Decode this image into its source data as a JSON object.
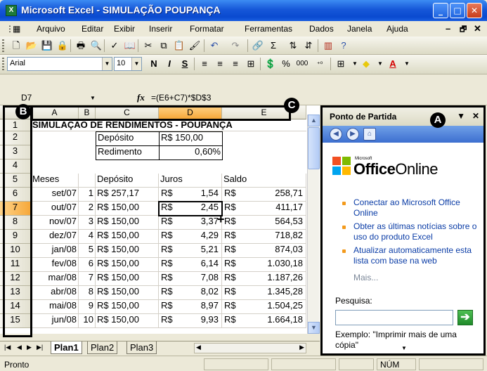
{
  "window": {
    "title": "Microsoft Excel - SIMULAÇÃO POUPANÇA",
    "app_icon": "X",
    "minimize": "_",
    "maximize": "□",
    "close": "✕"
  },
  "menu": {
    "items": [
      "Arquivo",
      "Editar",
      "Exibir",
      "Inserir",
      "Formatar",
      "Ferramentas",
      "Dados",
      "Janela",
      "Ajuda"
    ],
    "min_glyph": "–",
    "restore_glyph": "🗗",
    "close_glyph": "✕"
  },
  "toolbar_format": {
    "font": "Arial",
    "size": "10",
    "bold": "N",
    "italic": "I",
    "underline": "S",
    "percent": "%",
    "thousands": "000"
  },
  "formula_bar": {
    "cell_ref": "D7",
    "fx": "fx",
    "formula": "=(E6+C7)*$D$3"
  },
  "grid": {
    "columns": [
      "A",
      "B",
      "C",
      "D",
      "E"
    ],
    "rows": [
      "1",
      "2",
      "3",
      "4",
      "5",
      "6",
      "7",
      "8",
      "9",
      "10",
      "11",
      "12",
      "13",
      "14",
      "15"
    ],
    "title": "SIMULAÇÃO DE RENDIMENTOS - POUPANÇA",
    "deposito_label": "Depósito",
    "deposito_value": "R$ 150,00",
    "rendimento_label": "Redimento",
    "rendimento_value": "0,60%",
    "headers": [
      "Meses",
      "",
      "Depósito",
      "Juros",
      "Saldo"
    ],
    "currency": "R$",
    "data": [
      {
        "mes": "set/07",
        "n": "1",
        "deposito": "R$ 257,17",
        "juros": "1,54",
        "saldo": "258,71"
      },
      {
        "mes": "out/07",
        "n": "2",
        "deposito": "R$ 150,00",
        "juros": "2,45",
        "saldo": "411,17"
      },
      {
        "mes": "nov/07",
        "n": "3",
        "deposito": "R$ 150,00",
        "juros": "3,37",
        "saldo": "564,53"
      },
      {
        "mes": "dez/07",
        "n": "4",
        "deposito": "R$ 150,00",
        "juros": "4,29",
        "saldo": "718,82"
      },
      {
        "mes": "jan/08",
        "n": "5",
        "deposito": "R$ 150,00",
        "juros": "5,21",
        "saldo": "874,03"
      },
      {
        "mes": "fev/08",
        "n": "6",
        "deposito": "R$ 150,00",
        "juros": "6,14",
        "saldo": "1.030,18"
      },
      {
        "mes": "mar/08",
        "n": "7",
        "deposito": "R$ 150,00",
        "juros": "7,08",
        "saldo": "1.187,26"
      },
      {
        "mes": "abr/08",
        "n": "8",
        "deposito": "R$ 150,00",
        "juros": "8,02",
        "saldo": "1.345,28"
      },
      {
        "mes": "mai/08",
        "n": "9",
        "deposito": "R$ 150,00",
        "juros": "8,97",
        "saldo": "1.504,25"
      },
      {
        "mes": "jun/08",
        "n": "10",
        "deposito": "R$ 150,00",
        "juros": "9,93",
        "saldo": "1.664,18"
      }
    ]
  },
  "sheets": {
    "tabs": [
      "Plan1",
      "Plan2",
      "Plan3"
    ],
    "active": "Plan1"
  },
  "task_pane": {
    "title": "Ponto de Partida",
    "logo_small": "Microsoft",
    "logo_office": "Office",
    "logo_online": "Online",
    "links": [
      "Conectar ao Microsoft Office Online",
      "Obter as últimas notícias sobre o uso do produto Excel",
      "Atualizar automaticamente esta lista com base na web"
    ],
    "more": "Mais...",
    "search_label": "Pesquisa:",
    "search_value": "",
    "go_glyph": "➔",
    "example": "Exemplo: \"Imprimir mais de uma cópia\""
  },
  "callouts": {
    "a": "A",
    "b": "B",
    "c": "C"
  },
  "status": {
    "text": "Pronto",
    "num": "NÚM"
  },
  "colors": {
    "title_bar": "#0a4ad0",
    "selected_header": "#f6a83a",
    "link": "#0a3ca6",
    "bullet": "#f39a1c"
  }
}
